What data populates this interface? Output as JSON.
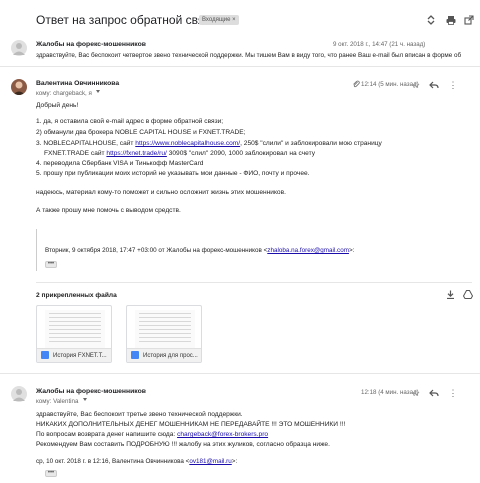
{
  "thread": {
    "subject": "Ответ на запрос обратной связи",
    "tag": "Входящие ×"
  },
  "collapsed_message": {
    "sender": "Жалобы на форекс-мошенников",
    "date": "9 окт. 2018 г., 14:47 (21 ч. назад)",
    "snippet": "здравствуйте, Вас беспокоит четвертое звено технической поддержки. Мы тишем Вам в виду того, что ранее Ваш e-mail был вписан в форме об"
  },
  "message1": {
    "sender": "Валентина Овчинникова",
    "to": "кому: chargeback, я",
    "time": "12:14 (5 мин. назад)",
    "greeting": "Добрый день!",
    "lines": [
      "1. да, я оставила свой e-mail адрес в форме обратной связи;",
      "2) обманули два брокера NOBLE CAPITAL HOUSE и FXNET.TRADE;",
      "3. NOBLECAPITALHOUSE, сайт ",
      "https://www.noblecapitalhouse.com/",
      ", 250$ \"слили\" и заблокировали мою страницу",
      "FXNET.TRADE сайт ",
      "https://fxnet.trade/ru/",
      " 3090$ \"слил\" 2090, 1000 заблокировал на счету",
      "4. переводила Сбербанк VISA и Тинькофф MasterCard",
      "5. прошу при публикации моих историй не указывать мои данные - ФИО, почту и прочее."
    ],
    "para2": "надеюсь, материал кому-то поможет и сильно осложнит жизнь этих мошенников.",
    "para3": "А также прошу мне помочь с выводом средств.",
    "quote_header": "Вторник, 9 октября 2018, 17:47 +03:00 от Жалобы на форекс-мошенников <",
    "quote_email": "zhaloba.na.forex@gmail.com",
    "quote_tail": ">:",
    "dots": "•••"
  },
  "attachments": {
    "title": "2 прикрепленных файла",
    "files": [
      "История FXNET.T...",
      "История для прос..."
    ]
  },
  "message2": {
    "sender": "Жалобы на форекс-мошенников",
    "to": "кому: Valentina",
    "time": "12:18 (4 мин. назад)",
    "l1": "здравствуйте, Вас беспокоит третье звено технической поддержки.",
    "l2": "НИКАКИХ ДОПОЛНИТЕЛЬНЫХ ДЕНЕГ МОШЕННИКАМ НЕ ПЕРЕДАВАЙТЕ !!! ЭТО МОШЕННИКИ !!!",
    "l3a": "По вопросам возврата денег напишите сюда: ",
    "l3b": "chargeback@forex-brokers.pro",
    "l4": "Рекомендуем Вам составить ПОДРОБНУЮ !!! жалобу на этих жуликов, согласно образца ниже.",
    "q1": "ср, 10 окт. 2018 г. в 12:16, Валентина Овчинникова <",
    "q1email": "ov181@mail.ru",
    "q1tail": ">:"
  }
}
